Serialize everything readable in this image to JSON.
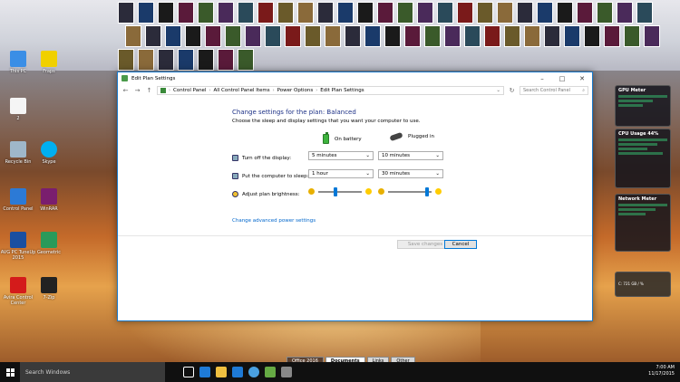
{
  "desktop": {
    "icons": [
      {
        "label": "This PC"
      },
      {
        "label": "Fraps"
      },
      {
        "label": "2"
      },
      {
        "label": "Recycle Bin"
      },
      {
        "label": "Skype"
      },
      {
        "label": "Control Panel"
      },
      {
        "label": "WinRAR"
      },
      {
        "label": "AVG PC TuneUp 2015"
      },
      {
        "label": "Geometric"
      },
      {
        "label": "Avira Control Center"
      },
      {
        "label": "7-Zip"
      }
    ],
    "gadgets": {
      "gpu_title": "GPU Meter",
      "cpu_title": "CPU Usage",
      "cpu_value": "44%",
      "network_title": "Network Meter",
      "drive_text": "C: 721 GB / %"
    }
  },
  "window": {
    "title": "Edit Plan Settings",
    "breadcrumbs": [
      "Control Panel",
      "All Control Panel Items",
      "Power Options",
      "Edit Plan Settings"
    ],
    "search_placeholder": "Search Control Panel",
    "heading": "Change settings for the plan: Balanced",
    "subheading": "Choose the sleep and display settings that you want your computer to use.",
    "col_battery": "On battery",
    "col_plugged": "Plugged in",
    "rows": {
      "display": {
        "label": "Turn off the display:",
        "battery": "5 minutes",
        "plugged": "10 minutes"
      },
      "sleep": {
        "label": "Put the computer to sleep:",
        "battery": "1 hour",
        "plugged": "30 minutes"
      },
      "brightness": {
        "label": "Adjust plan brightness:",
        "battery_level": 0.4,
        "plugged_level": 0.9
      }
    },
    "advanced_link": "Change advanced power settings",
    "save_button": "Save changes",
    "cancel_button": "Cancel"
  },
  "taskbar": {
    "search_placeholder": "Search Windows",
    "time": "7:00 AM",
    "date": "11/17/2015",
    "desktop_tabs": [
      "Office 2016",
      "Documents",
      "Links",
      "Other"
    ]
  },
  "colors": {
    "accent": "#0078d7",
    "heading": "#1e3287",
    "link": "#0066cc"
  }
}
